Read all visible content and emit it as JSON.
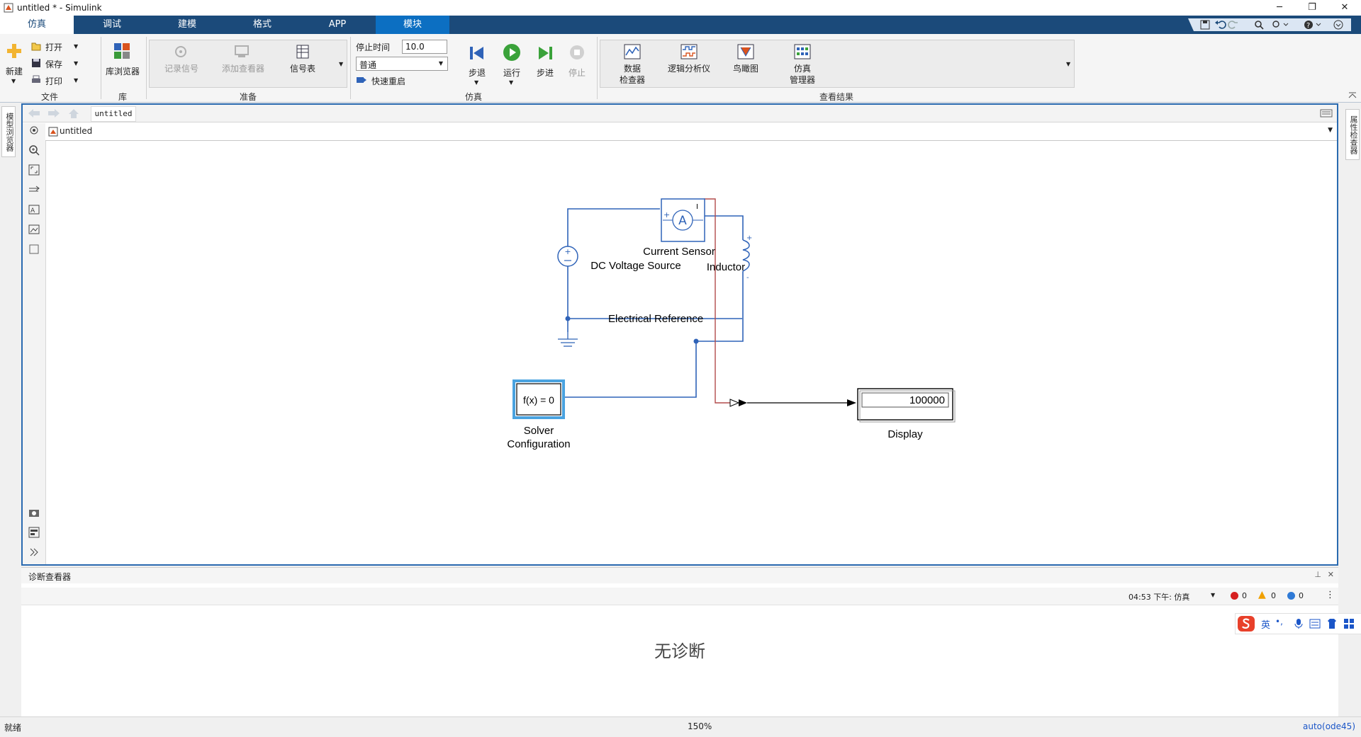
{
  "window": {
    "title": "untitled * - Simulink",
    "controls": {
      "minimize": "─",
      "restore": "❐",
      "close": "✕"
    }
  },
  "tabs": [
    {
      "label": "仿真"
    },
    {
      "label": "调试"
    },
    {
      "label": "建模"
    },
    {
      "label": "格式"
    },
    {
      "label": "APP"
    },
    {
      "label": "模块"
    }
  ],
  "ribbon": {
    "file": {
      "new": "新建",
      "open": "打开",
      "save": "保存",
      "print": "打印",
      "group": "文件"
    },
    "library": {
      "browser": "库浏览器",
      "group": "库"
    },
    "prepare": {
      "log_signals": "记录信号",
      "add_viewer": "添加查看器",
      "signal_table": "信号表",
      "group": "准备"
    },
    "simulate": {
      "stop_time_label": "停止时间",
      "stop_time_value": "10.0",
      "mode": "普通",
      "fast_restart": "快速重启",
      "step_back": "步退",
      "run": "运行",
      "step_forward": "步进",
      "stop": "停止",
      "group": "仿真"
    },
    "review": {
      "data_inspector": [
        "数据",
        "检查器"
      ],
      "logic_analyzer": "逻辑分析仪",
      "bird_eye": "鸟瞰图",
      "sim_manager": [
        "仿真",
        "管理器"
      ],
      "group": "查看结果"
    }
  },
  "side": {
    "left_tab": "模型浏览器",
    "right_tab": "属性检查器"
  },
  "editor": {
    "breadcrumb_tab": "untitled",
    "address": "untitled",
    "blocks": {
      "current_sensor": "Current Sensor",
      "dc_source": "DC Voltage Source",
      "inductor": "Inductor",
      "reference": "Electrical Reference",
      "solver_text": "f(x) = 0",
      "solver_label_1": "Solver",
      "solver_label_2": "Configuration",
      "display_value": "100000",
      "display_label": "Display",
      "ammeter_glyph": "A",
      "port_plus": "+",
      "port_minus": "-",
      "port_i": "I"
    }
  },
  "diagnostics": {
    "title": "诊断查看器",
    "time_filter": "04:53 下午: 仿真",
    "errors": "0",
    "warnings": "0",
    "infos": "0",
    "empty_text": "无诊断"
  },
  "status": {
    "left": "就绪",
    "zoom": "150%",
    "solver": "auto(ode45)"
  },
  "ime": {
    "lang": "英",
    "punct": "•,"
  },
  "colors": {
    "ribbon_tab_bg": "#1b4a7a",
    "active_tab": "#0c6fc2",
    "wire": "#2f63b8",
    "signal": "#b24b4b",
    "frame": "#2a6ab0"
  }
}
